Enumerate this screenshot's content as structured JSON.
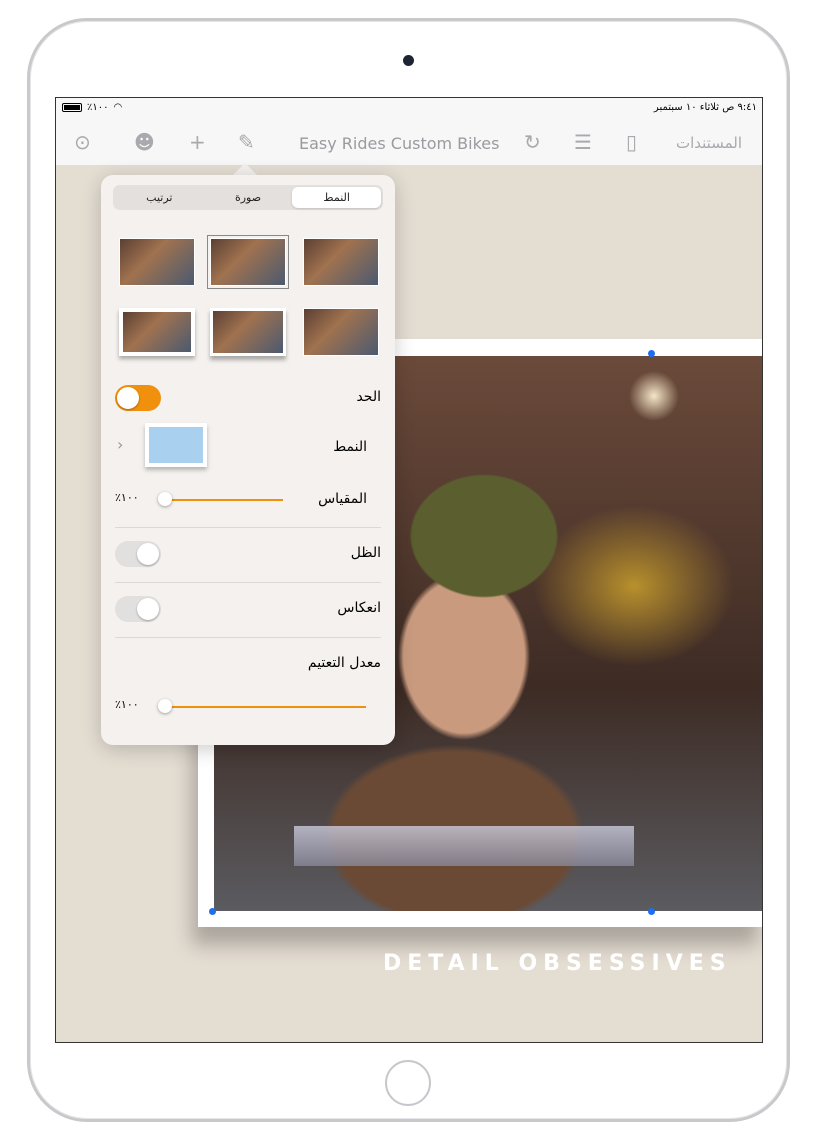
{
  "status": {
    "time_date": "٩:٤١ ص   ثلاثاء ١٠ سبتمبر",
    "battery": "٪١٠٠"
  },
  "toolbar": {
    "title": "Easy Rides Custom Bikes",
    "documents": "المستندات",
    "icons": [
      "more-icon",
      "collaborate-icon",
      "add-icon",
      "format-brush-icon",
      "undo-icon",
      "outline-icon",
      "sidebar-icon"
    ]
  },
  "canvas": {
    "caption": "DETAIL OBSESSIVES"
  },
  "popover": {
    "tabs": [
      {
        "label": "النمط",
        "selected": true
      },
      {
        "label": "صورة",
        "selected": false
      },
      {
        "label": "ترتيب",
        "selected": false
      }
    ],
    "border": {
      "label": "الحد",
      "on": true
    },
    "style": {
      "label": "النمط",
      "swatch_color": "#a9d0ee"
    },
    "scale": {
      "label": "المقياس",
      "value_text": "٪١٠٠",
      "percent": 100
    },
    "shadow": {
      "label": "الظل",
      "on": false
    },
    "reflection": {
      "label": "انعكاس",
      "on": false
    },
    "opacity": {
      "label": "معدل التعتيم",
      "value_text": "٪١٠٠",
      "percent": 100
    }
  },
  "colors": {
    "accent": "#f0900c",
    "selection": "#1e6ff0"
  }
}
